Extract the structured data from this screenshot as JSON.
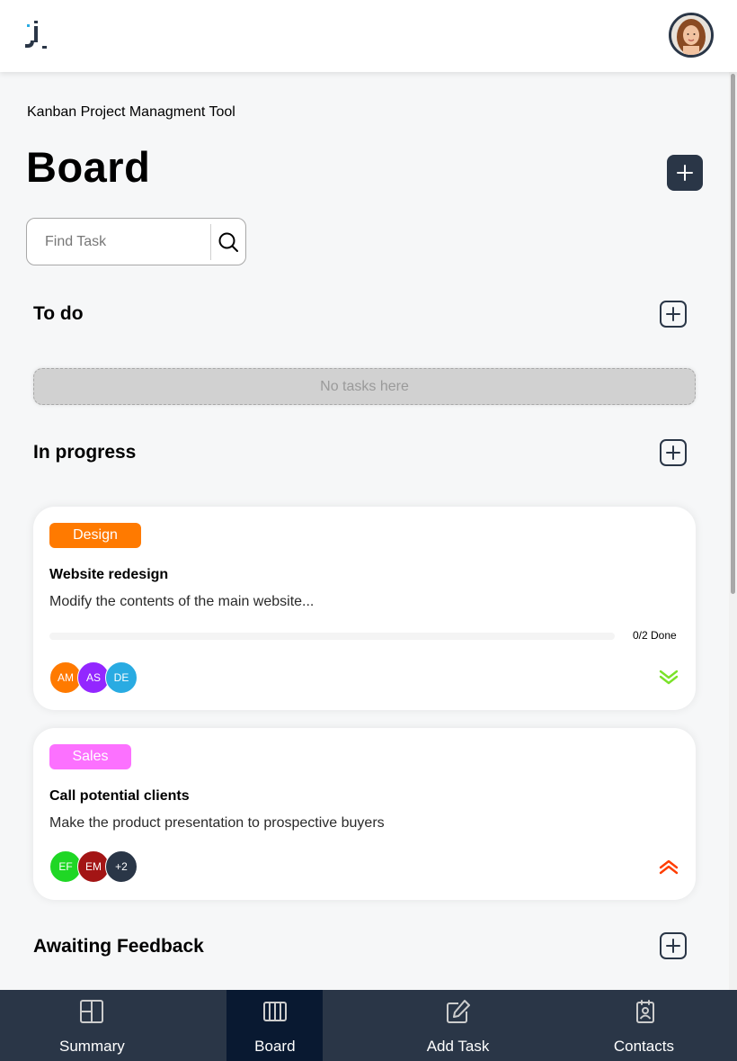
{
  "app": {
    "subtitle": "Kanban Project Managment Tool",
    "title": "Board"
  },
  "search": {
    "placeholder": "Find Task",
    "value": ""
  },
  "columns": [
    {
      "title": "To do",
      "empty_text": "No tasks here"
    },
    {
      "title": "In progress"
    },
    {
      "title": "Awaiting Feedback"
    }
  ],
  "cards": [
    {
      "category": "Design",
      "category_color": "#ff7a00",
      "title": "Website redesign",
      "description": "Modify the contents of the main website...",
      "subtasks_done": 0,
      "subtasks_total": 2,
      "progress_label": "0/2 Done",
      "assignees": [
        {
          "initials": "AM",
          "color": "#ff7a00"
        },
        {
          "initials": "AS",
          "color": "#9327ff"
        },
        {
          "initials": "DE",
          "color": "#29abe2"
        }
      ],
      "priority": "low",
      "priority_color": "#7ae229"
    },
    {
      "category": "Sales",
      "category_color": "#fc71ff",
      "title": "Call potential clients",
      "description": "Make the product presentation to prospective buyers",
      "assignees": [
        {
          "initials": "EF",
          "color": "#1fd725"
        },
        {
          "initials": "EM",
          "color": "#a31515"
        },
        {
          "initials": "+2",
          "color": "#2a3647"
        }
      ],
      "priority": "urgent",
      "priority_color": "#ff3d00"
    }
  ],
  "nav": [
    {
      "label": "Summary",
      "icon": "summary-icon",
      "active": false
    },
    {
      "label": "Board",
      "icon": "board-icon",
      "active": true
    },
    {
      "label": "Add Task",
      "icon": "add-task-icon",
      "active": false
    },
    {
      "label": "Contacts",
      "icon": "contacts-icon",
      "active": false
    }
  ],
  "colors": {
    "primary": "#2a3647",
    "nav_active": "#091931"
  }
}
